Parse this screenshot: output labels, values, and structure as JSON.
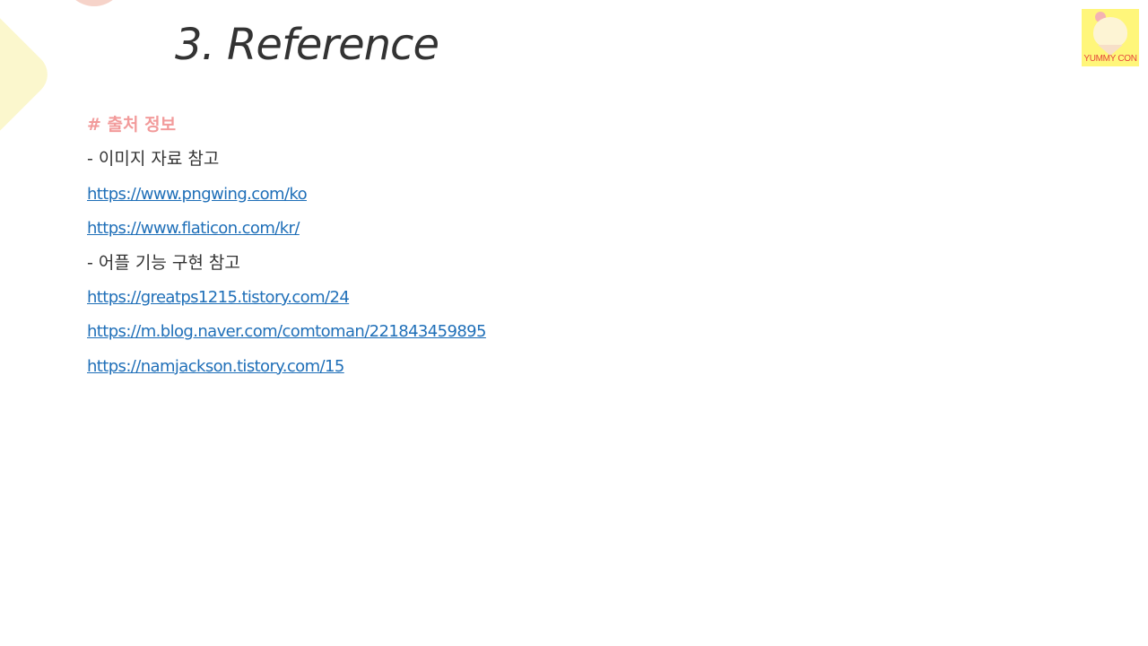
{
  "slide": {
    "title": "3. Reference"
  },
  "logo": {
    "label": "YUMMY CON"
  },
  "colors": {
    "heading": "#f29b9b",
    "link": "#1f6fb8",
    "text": "#333333",
    "deco_pink": "#f6d3c9",
    "deco_yellow": "#fbf7cd",
    "logo_bg": "#fff67a"
  },
  "references": {
    "heading": "# 출처 정보",
    "image_section": {
      "label": "- 이미지 자료 참고",
      "links": [
        "https://www.pngwing.com/ko",
        "https://www.flaticon.com/kr/"
      ]
    },
    "app_section": {
      "label": "- 어플 기능 구현 참고",
      "links": [
        "https://greatps1215.tistory.com/24",
        "https://m.blog.naver.com/comtoman/221843459895",
        "https://namjackson.tistory.com/15"
      ]
    }
  }
}
